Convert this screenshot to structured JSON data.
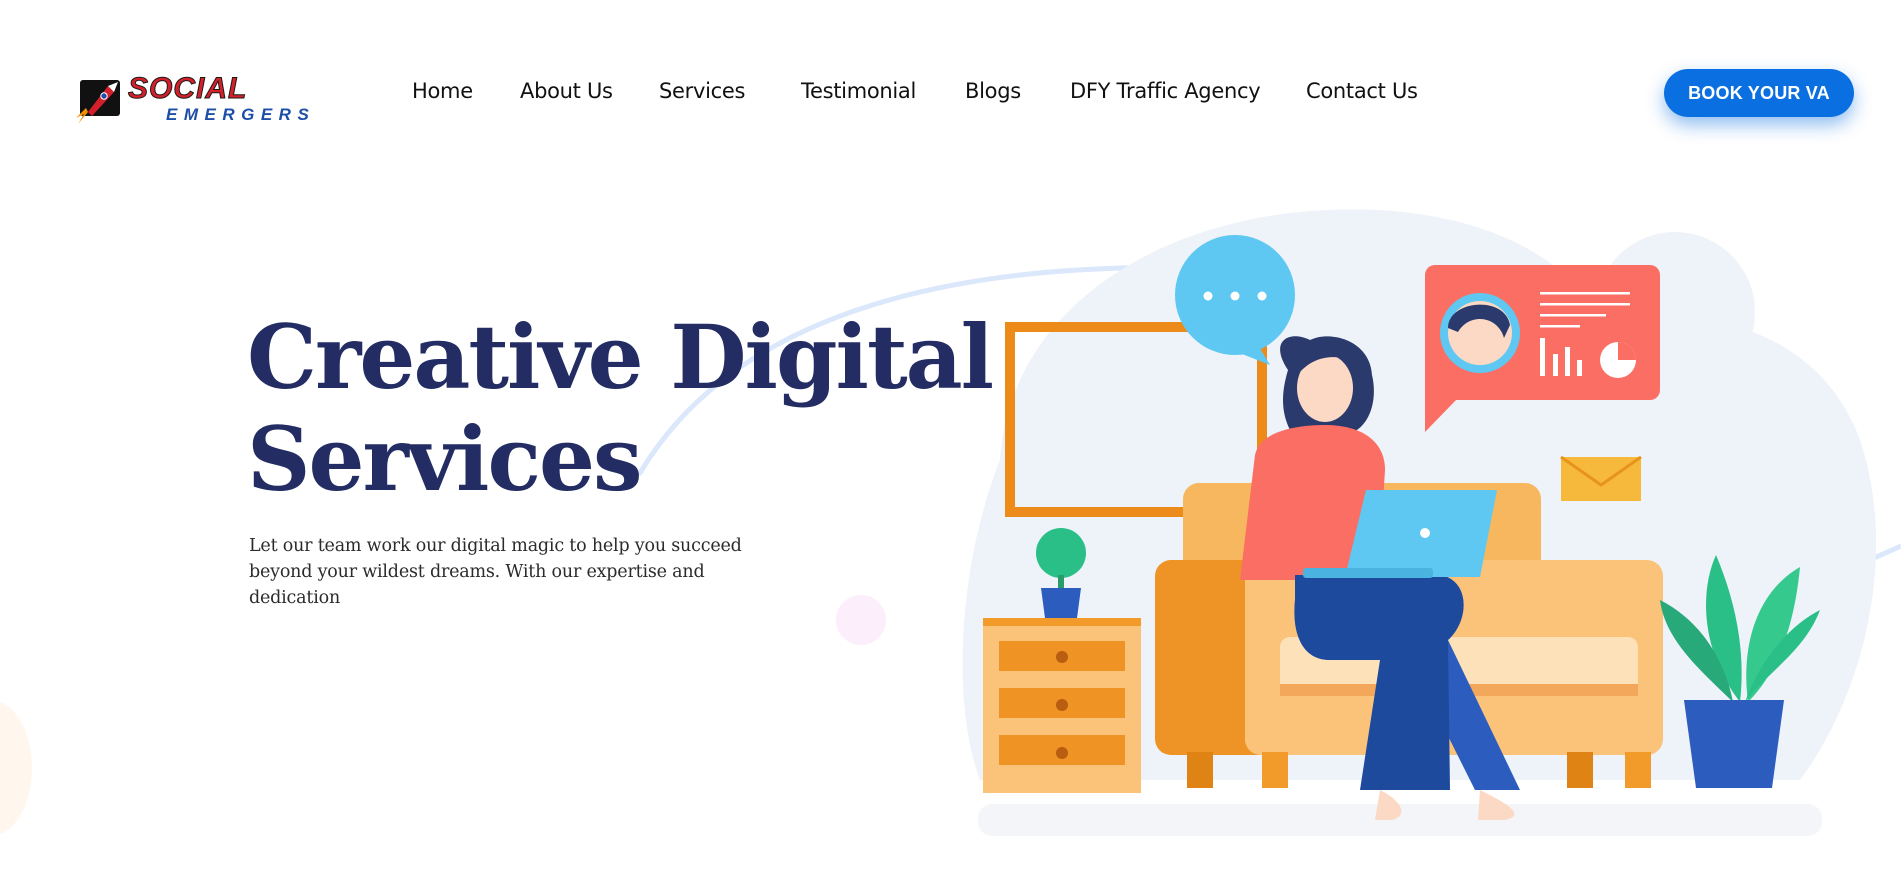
{
  "brand": {
    "name_line1": "SOCIAL",
    "name_line2": "EMERGERS"
  },
  "nav": {
    "items": [
      {
        "label": "Home"
      },
      {
        "label": "About Us"
      },
      {
        "label": "Services"
      },
      {
        "label": "Testimonial"
      },
      {
        "label": "Blogs"
      },
      {
        "label": "DFY Traffic Agency"
      },
      {
        "label": "Contact Us"
      }
    ]
  },
  "header": {
    "cta_label": "BOOK YOUR VA"
  },
  "hero": {
    "title_line1": "Creative Digital",
    "title_line2": "Services",
    "subtitle": "Let our team work our digital magic to help you succeed beyond your wildest dreams. With our expertise and dedication"
  },
  "colors": {
    "accent": "#0a6fe0",
    "title": "#232d63",
    "logo_red": "#d4202a",
    "logo_blue": "#1d4fa8"
  },
  "icons": [
    "rocket-logo-icon",
    "chat-bubble-icon",
    "profile-card-icon",
    "envelope-icon",
    "laptop-icon"
  ]
}
